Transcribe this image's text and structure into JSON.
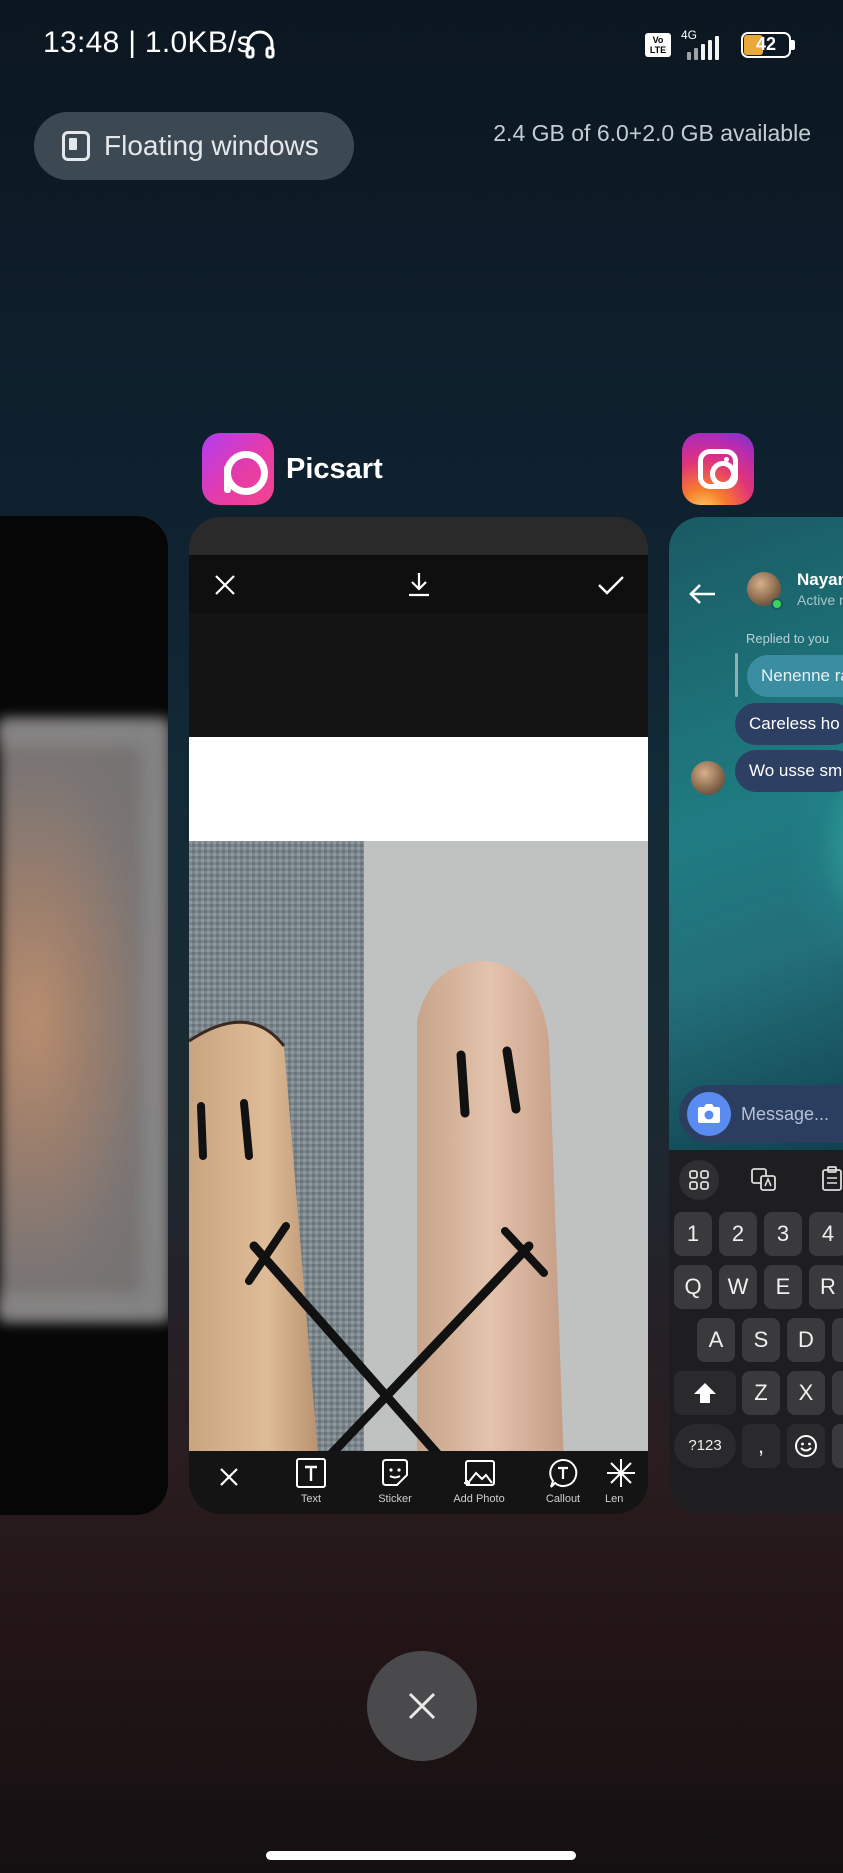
{
  "status_bar": {
    "time_speed": "13:48 | 1.0KB/s",
    "volte": "Vo LTE",
    "network": "4G",
    "battery": "42",
    "battery_level": 0.42
  },
  "recents": {
    "floating_windows_label": "Floating windows",
    "memory_text": "2.4 GB of 6.0+2.0 GB available"
  },
  "picsart": {
    "app_name": "Picsart",
    "tools": [
      {
        "label": "Text",
        "icon": "text-icon"
      },
      {
        "label": "Sticker",
        "icon": "sticker-icon"
      },
      {
        "label": "Add Photo",
        "icon": "add-photo-icon"
      },
      {
        "label": "Callout",
        "icon": "callout-icon"
      },
      {
        "label": "Len",
        "icon": "lens-flare-icon"
      }
    ]
  },
  "instagram": {
    "contact_name": "Nayan",
    "active_status": "Active n",
    "replied_label": "Replied to you",
    "messages": [
      "Nenenne ra",
      "Careless ho",
      "Wo usse sm"
    ],
    "message_placeholder": "Message...",
    "keyboard": {
      "numbers": [
        "1",
        "2",
        "3",
        "4"
      ],
      "row_q": [
        "Q",
        "W",
        "E",
        "R"
      ],
      "row_a": [
        "A",
        "S",
        "D"
      ],
      "row_z": [
        "Z",
        "X"
      ],
      "sym_key": "?123",
      "comma_key": ","
    }
  },
  "colors": {
    "picsart_gradient_start": "#b23cf3",
    "picsart_gradient_end": "#f3458e",
    "instagram_bubble": "#2d3f63"
  }
}
